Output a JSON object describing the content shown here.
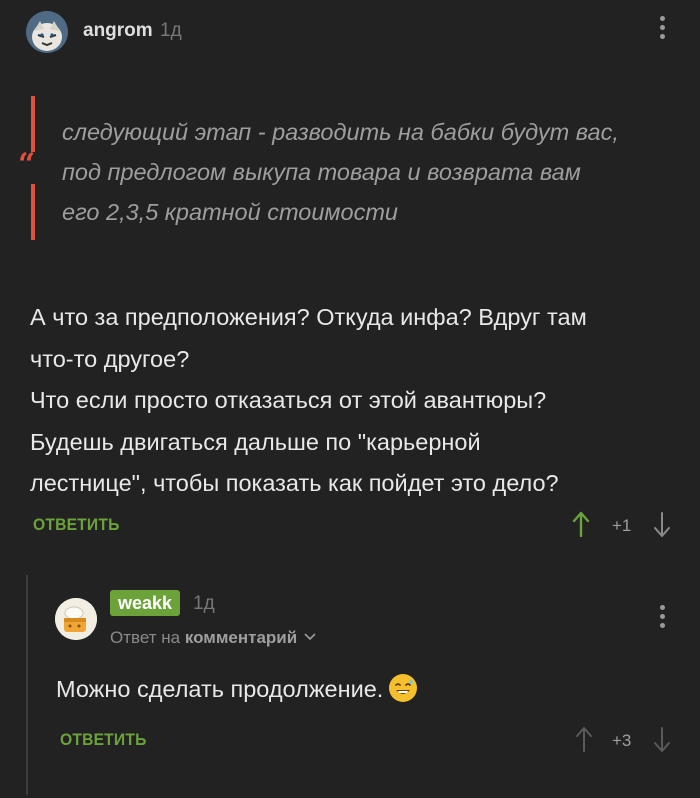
{
  "comment1": {
    "username": "angrom",
    "time": "1д",
    "quote": [
      "следующий этап - разводить на бабки будут вас,",
      "под предлогом выкупа товара и возврата вам",
      "его 2,3,5 кратной стоимости"
    ],
    "body": [
      "А что за предположения? Откуда инфа? Вдруг там",
      "что-то другое?",
      "Что если просто отказаться от этой авантюры?",
      "Будешь двигаться дальше по \"карьерной",
      "лестнице\", чтобы показать как пойдет это дело?"
    ],
    "reply_label": "ОТВЕТИТЬ",
    "rating": "+1"
  },
  "comment2": {
    "username": "weakk",
    "time": "1д",
    "reply_to_prefix": "Ответ на",
    "reply_to_link": "комментарий",
    "body": "Можно сделать продолжение.",
    "reply_label": "ОТВЕТИТЬ",
    "rating": "+3"
  },
  "colors": {
    "background": "#222222",
    "accent_green": "#6ba33a",
    "quote_red": "#e0503a"
  },
  "icons": {
    "upvote": "arrow-up-icon",
    "downvote": "arrow-down-icon",
    "menu": "more-vertical-icon",
    "quote": "quote-icon",
    "expand": "chevron-down-icon",
    "emoji": "sweat-smile-emoji"
  }
}
